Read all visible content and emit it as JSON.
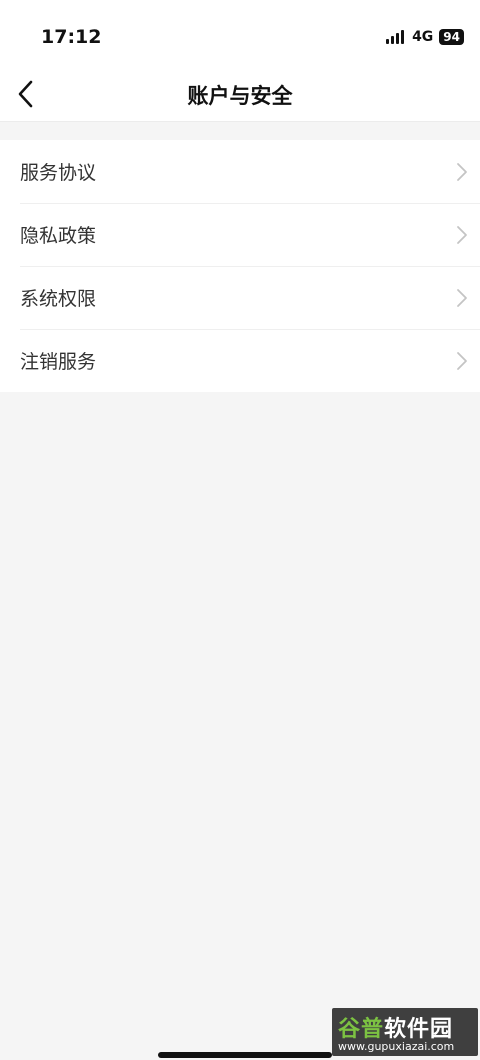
{
  "status_bar": {
    "time": "17:12",
    "network": "4G",
    "battery": "94",
    "icons": {
      "signal": "signal-bars-icon",
      "battery": "battery-icon"
    }
  },
  "nav": {
    "back_icon": "chevron-left-icon",
    "title": "账户与安全"
  },
  "settings": {
    "items": [
      {
        "label": "服务协议",
        "icon": "chevron-right-icon"
      },
      {
        "label": "隐私政策",
        "icon": "chevron-right-icon"
      },
      {
        "label": "系统权限",
        "icon": "chevron-right-icon"
      },
      {
        "label": "注销服务",
        "icon": "chevron-right-icon"
      }
    ]
  },
  "watermark": {
    "logo_green": "谷普",
    "logo_white": "软件园",
    "url": "www.gupuxiazai.com"
  },
  "colors": {
    "background": "#f5f5f5",
    "card": "#ffffff",
    "text_primary": "#111111",
    "text_item": "#333333",
    "chevron": "#c4c4c4",
    "watermark_green": "#7cc242"
  }
}
